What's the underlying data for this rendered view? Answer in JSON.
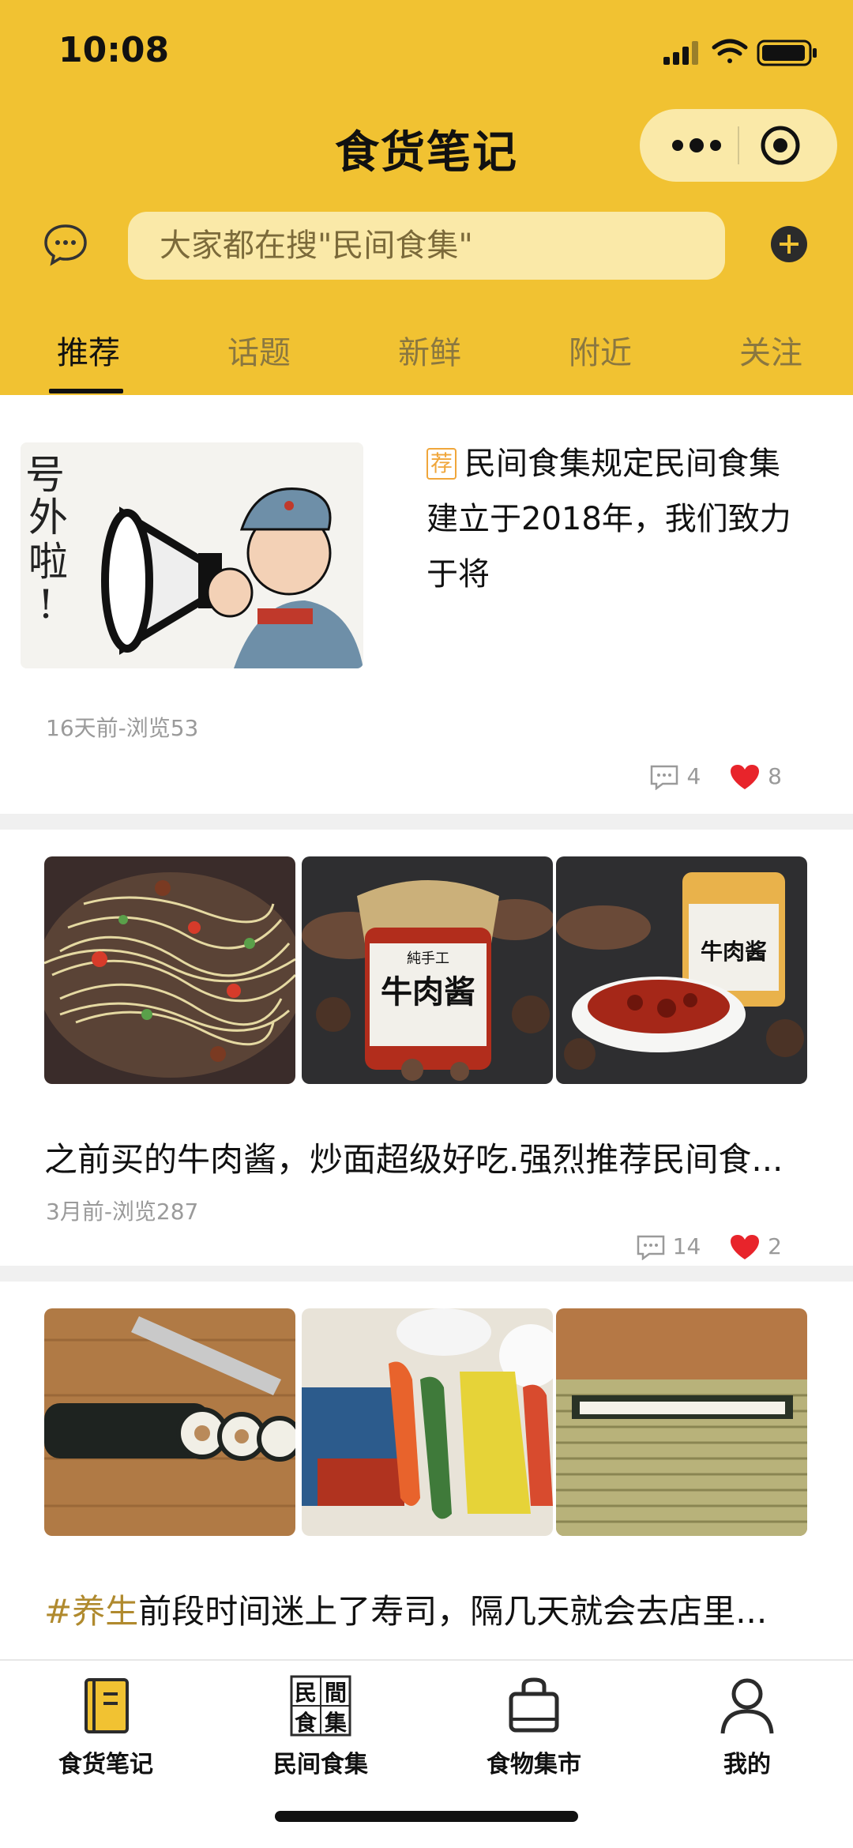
{
  "status_bar": {
    "time": "10:08"
  },
  "header": {
    "title": "食货笔记",
    "search_placeholder": "大家都在搜\"民间食集\""
  },
  "tabs": [
    {
      "label": "推荐",
      "active": true
    },
    {
      "label": "话题"
    },
    {
      "label": "新鲜"
    },
    {
      "label": "附近"
    },
    {
      "label": "关注"
    }
  ],
  "feed": [
    {
      "tag": "荐",
      "text": "民间食集规定民间食集建立于2018年，我们致力于将",
      "meta": "16天前-浏览53",
      "comments": "4",
      "likes": "8",
      "image_text": "号外啦！"
    },
    {
      "text": "之前买的牛肉酱，炒面超级好吃.强烈推荐民间食...",
      "meta": "3月前-浏览287",
      "comments": "14",
      "likes": "2",
      "jar_label": "牛肉酱",
      "jar_sub": "純手工"
    },
    {
      "hashtag": "#养生",
      "text": "前段时间迷上了寿司，隔几天就会去店里..."
    }
  ],
  "bottom_nav": [
    {
      "label": "食货笔记",
      "icon": "notebook-icon"
    },
    {
      "label": "民间食集",
      "icon": "logo-icon",
      "logo_text": "民間食集"
    },
    {
      "label": "食物集市",
      "icon": "bag-icon"
    },
    {
      "label": "我的",
      "icon": "person-icon"
    }
  ],
  "colors": {
    "header_bg": "#f1c232",
    "search_bg": "#fae9a8",
    "like_red": "#e8242b",
    "tag_orange": "#f0a63a"
  }
}
